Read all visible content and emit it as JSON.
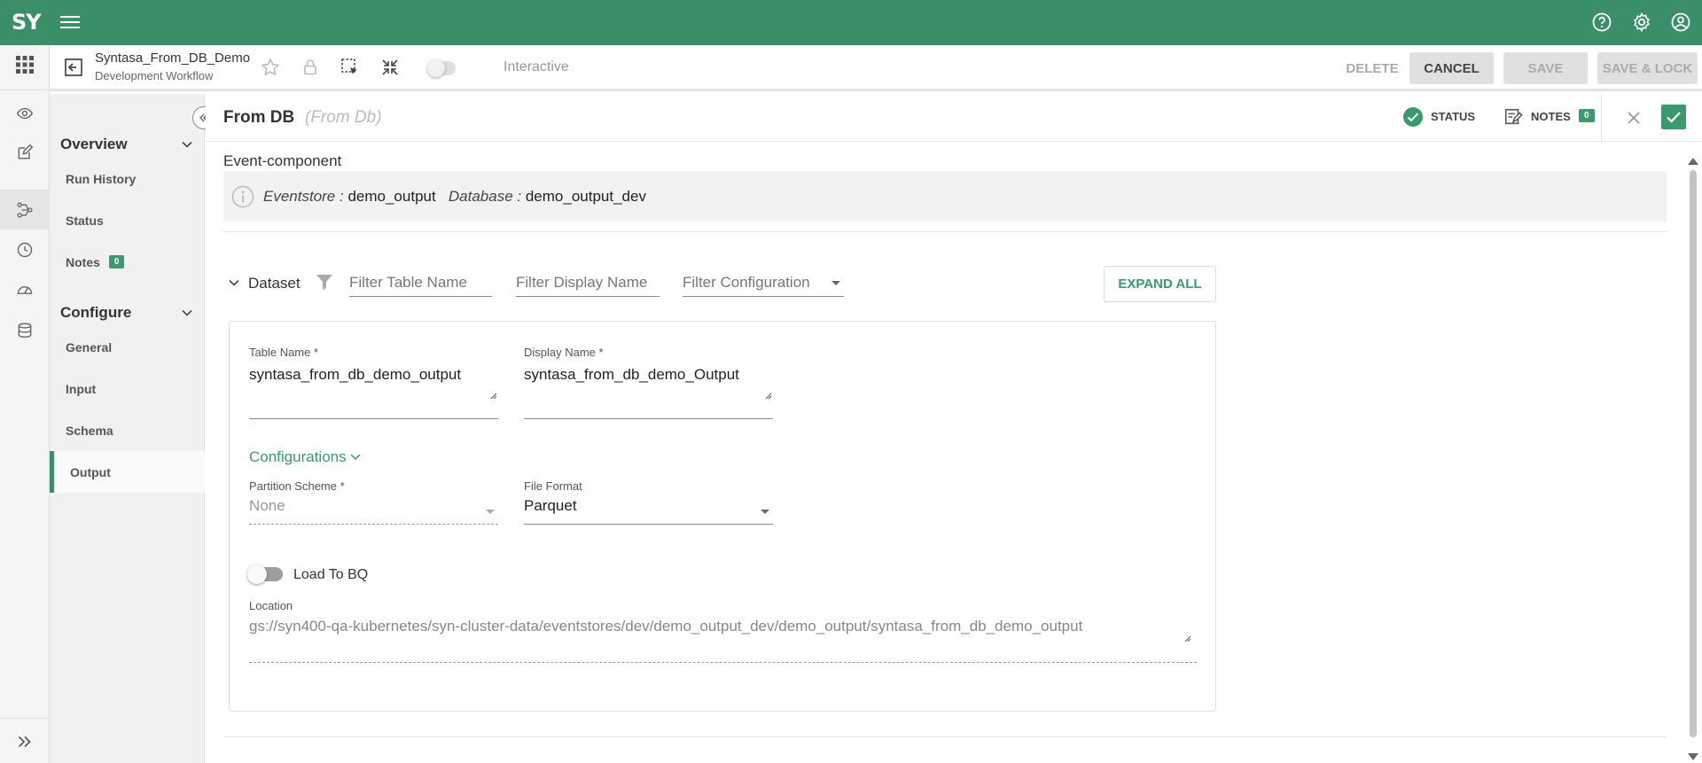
{
  "app": {
    "logo": "SY"
  },
  "workflow": {
    "title": "Syntasa_From_DB_Demo",
    "subtitle": "Development Workflow",
    "interactive_label": "Interactive"
  },
  "toolbar": {
    "delete_label": "DELETE",
    "cancel_label": "CANCEL",
    "save_label": "SAVE",
    "save_lock_label": "SAVE & LOCK"
  },
  "sidebar": {
    "overview_label": "Overview",
    "configure_label": "Configure",
    "overview_items": [
      {
        "label": "Run History"
      },
      {
        "label": "Status"
      },
      {
        "label": "Notes",
        "badge": "0"
      }
    ],
    "configure_items": [
      {
        "label": "General"
      },
      {
        "label": "Input"
      },
      {
        "label": "Schema"
      },
      {
        "label": "Output",
        "active": true
      }
    ]
  },
  "panel": {
    "title": "From DB",
    "subtitle": "(From Db)",
    "status_label": "STATUS",
    "notes_label": "NOTES",
    "notes_count": "0"
  },
  "event_component": {
    "label": "Event-component",
    "eventstore_key": "Eventstore :",
    "eventstore_value": "demo_output",
    "database_key": "Database :",
    "database_value": "demo_output_dev"
  },
  "dataset": {
    "label": "Dataset",
    "filter_table_placeholder": "Filter Table Name",
    "filter_display_placeholder": "Filter Display Name",
    "filter_config_placeholder": "Filter Configuration",
    "expand_all_label": "EXPAND ALL",
    "table_name_label": "Table Name *",
    "table_name_value": "syntasa_from_db_demo_output",
    "display_name_label": "Display Name *",
    "display_name_value": "syntasa_from_db_demo_Output",
    "configurations_label": "Configurations",
    "partition_label": "Partition Scheme *",
    "partition_value": "None",
    "file_format_label": "File Format",
    "file_format_value": "Parquet",
    "load_bq_label": "Load To BQ",
    "load_bq_enabled": false,
    "location_label": "Location",
    "location_value": "gs://syn400-qa-kubernetes/syn-cluster-data/eventstores/dev/demo_output_dev/demo_output/syntasa_from_db_demo_output"
  },
  "colors": {
    "brand": "#3a8f68",
    "accent": "#3a9a6e"
  },
  "icons": [
    "menu-icon",
    "help-icon",
    "settings-icon",
    "account-icon",
    "apps-icon",
    "eye-icon",
    "edit-icon",
    "workflow-icon",
    "history-icon",
    "dashboard-icon",
    "storage-icon",
    "expand-rail-icon",
    "back-icon",
    "star-icon",
    "lock-icon",
    "select-icon",
    "fit-icon",
    "collapse-icon",
    "status-check-icon",
    "notes-icon",
    "close-icon",
    "confirm-icon",
    "info-icon",
    "filter-icon"
  ]
}
